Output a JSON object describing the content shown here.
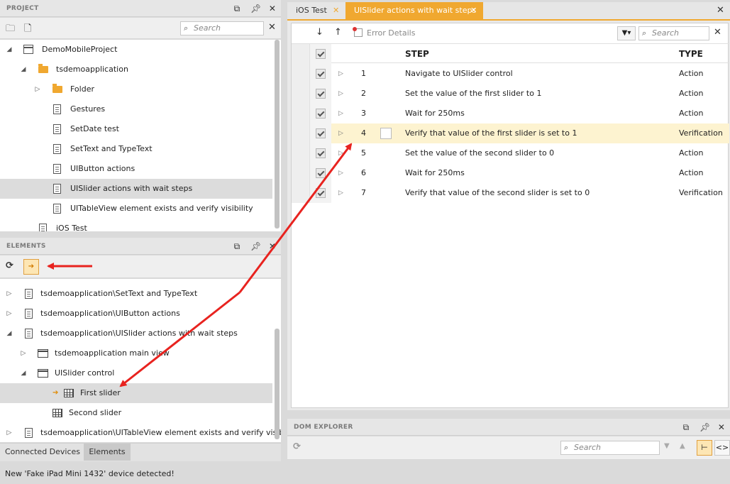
{
  "project_panel": {
    "title": "PROJECT",
    "search_placeholder": "Search",
    "tree": [
      {
        "label": "DemoMobileProject"
      },
      {
        "label": "tsdemoapplication"
      },
      {
        "label": "Folder"
      },
      {
        "label": "Gestures"
      },
      {
        "label": "SetDate test"
      },
      {
        "label": "SetText and TypeText"
      },
      {
        "label": "UIButton actions"
      },
      {
        "label": "UISlider actions with wait steps"
      },
      {
        "label": "UITableView element exists and verify visibility"
      },
      {
        "label": "iOS Test"
      }
    ]
  },
  "elements_panel": {
    "title": "ELEMENTS",
    "tree": [
      {
        "label": "tsdemoapplication\\SetText and TypeText"
      },
      {
        "label": "tsdemoapplication\\UIButton actions"
      },
      {
        "label": "tsdemoapplication\\UISlider actions with wait steps"
      },
      {
        "label": "tsdemoapplication main view"
      },
      {
        "label": "UISlider control"
      },
      {
        "label": "First slider"
      },
      {
        "label": "Second slider"
      },
      {
        "label": "tsdemoapplication\\UITableView element exists and verify visibility"
      }
    ],
    "tabs": [
      "Connected Devices",
      "Elements"
    ]
  },
  "editor": {
    "tabs": [
      {
        "label": "iOS Test",
        "active": false
      },
      {
        "label": "UISlider actions with wait steps",
        "active": true
      }
    ],
    "toolbar": {
      "error_details": "Error Details",
      "search_placeholder": "Search"
    },
    "columns": {
      "step": "STEP",
      "type": "TYPE"
    },
    "rows": [
      {
        "num": "1",
        "step": "Navigate to UISlider control",
        "type": "Action"
      },
      {
        "num": "2",
        "step": "Set the value of the first slider to 1",
        "type": "Action"
      },
      {
        "num": "3",
        "step": "Wait for 250ms",
        "type": "Action"
      },
      {
        "num": "4",
        "step": "Verify that value of the first slider is set to 1",
        "type": "Verification"
      },
      {
        "num": "5",
        "step": "Set the value of the second slider to 0",
        "type": "Action"
      },
      {
        "num": "6",
        "step": "Wait for 250ms",
        "type": "Action"
      },
      {
        "num": "7",
        "step": "Verify that value of the second slider is set to 0",
        "type": "Verification"
      }
    ]
  },
  "dom_explorer": {
    "title": "DOM EXPLORER",
    "search_placeholder": "Search"
  },
  "status": {
    "message": "New 'Fake iPad Mini 1432' device detected!"
  },
  "colors": {
    "accent_orange": "#f0a830",
    "highlight_row": "#fdf3d0",
    "arrow_red": "#e8231f"
  }
}
